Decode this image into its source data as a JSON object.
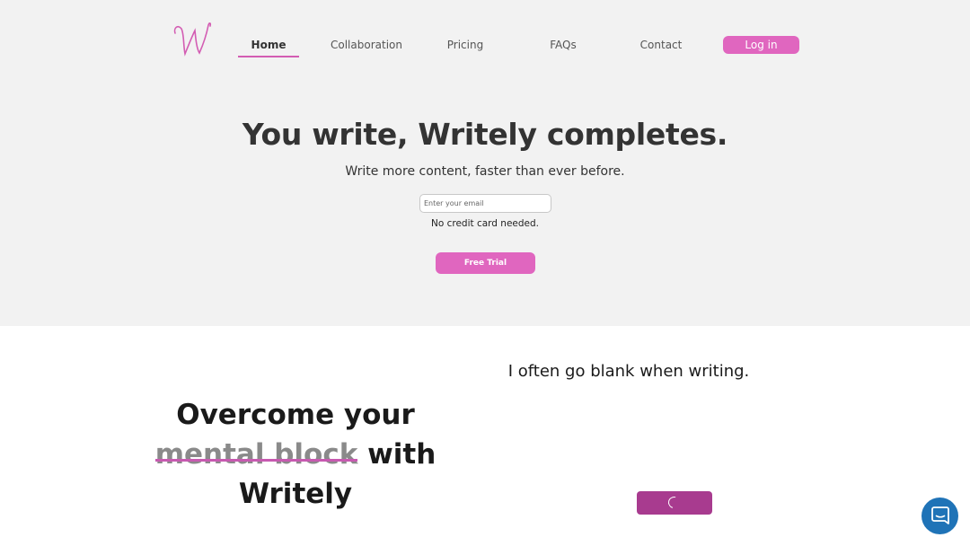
{
  "header": {
    "logo_text": "W",
    "nav": [
      {
        "label": "Home",
        "active": true
      },
      {
        "label": "Collaboration",
        "active": false
      },
      {
        "label": "Pricing",
        "active": false
      },
      {
        "label": "FAQs",
        "active": false
      },
      {
        "label": "Contact",
        "active": false
      }
    ],
    "login_label": "Log in"
  },
  "hero": {
    "title": "You write, Writely completes.",
    "subtitle": "Write more content, faster than ever before.",
    "email_placeholder": "Enter your email",
    "note": "No credit card needed.",
    "cta_label": "Free Trial"
  },
  "feature": {
    "line1": "Overcome your",
    "struck": "mental block",
    "after_struck": " with",
    "line3": "Writely",
    "quote": "I often go blank when writing."
  },
  "colors": {
    "accent": "#e066bf",
    "accent_dark": "#a83b8f",
    "chat": "#1f73b7",
    "hero_bg": "#f2f2f2"
  },
  "icons": {
    "logo": "script-w-logo",
    "loading": "spinner-icon",
    "chat": "chat-bubble-icon"
  }
}
